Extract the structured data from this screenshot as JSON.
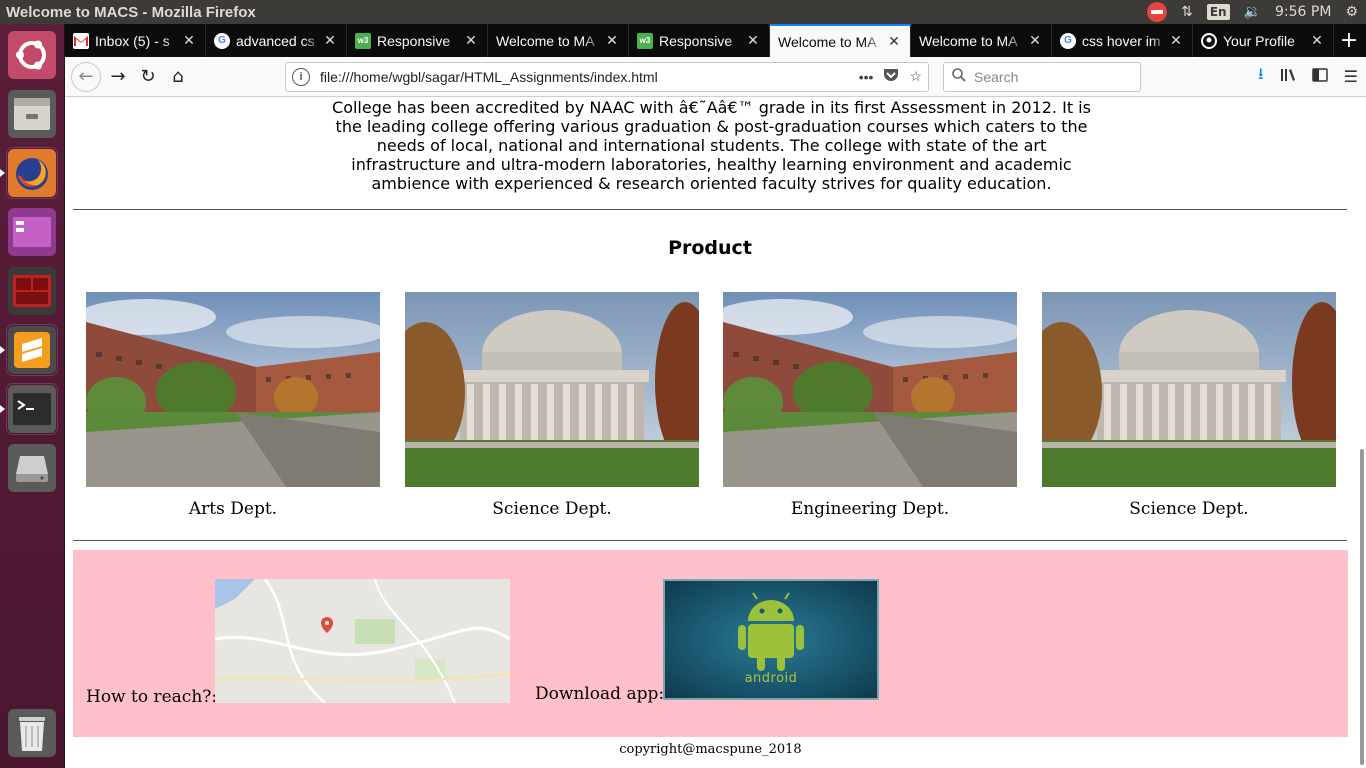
{
  "top_panel": {
    "window_title": "Welcome to MACS - Mozilla Firefox",
    "language": "En",
    "clock": "9:56 PM"
  },
  "launcher": {
    "items": [
      "ubuntu-dash-icon",
      "files-icon",
      "firefox-icon",
      "media-icon",
      "system-monitor-icon",
      "sublime-text-icon",
      "terminal-icon",
      "disk-icon",
      "trash-icon"
    ]
  },
  "tabs": [
    {
      "label": "Inbox (5) - s",
      "icon": "gmail-icon",
      "selected": false
    },
    {
      "label": "advanced cs",
      "icon": "google-icon",
      "selected": false
    },
    {
      "label": "Responsive",
      "icon": "w3schools-icon",
      "selected": false
    },
    {
      "label": "Welcome to MA",
      "icon": "",
      "selected": false
    },
    {
      "label": "Responsive",
      "icon": "w3schools-icon",
      "selected": false
    },
    {
      "label": "Welcome to MA",
      "icon": "",
      "selected": true
    },
    {
      "label": "Welcome to MA",
      "icon": "",
      "selected": false
    },
    {
      "label": "css hover im",
      "icon": "google-icon",
      "selected": false
    },
    {
      "label": "Your Profile",
      "icon": "github-icon",
      "selected": false
    }
  ],
  "navbar": {
    "url": "file:///home/wgbl/sagar/HTML_Assignments/index.html",
    "search_placeholder": "Search"
  },
  "page": {
    "intro_lines": [
      "College has been accredited by NAAC with â€˜Aâ€™ grade in its first Assessment in 2012. It is",
      "the leading college offering various graduation & post-graduation courses which caters to the",
      "needs of local, national and international students. The college with state of the art",
      "infrastructure and ultra-modern laboratories, healthy learning environment and academic",
      "ambience with experienced & research oriented faculty strives for quality education."
    ],
    "product_title": "Product",
    "departments": [
      {
        "caption": "Arts Dept.",
        "image": "campus-photo"
      },
      {
        "caption": "Science Dept.",
        "image": "dome-building-photo"
      },
      {
        "caption": "Engineering Dept.",
        "image": "campus-photo"
      },
      {
        "caption": "Science Dept.",
        "image": "dome-building-photo"
      }
    ],
    "how_to_reach": "How to reach?:",
    "download_app": "Download app:",
    "android_word": "android",
    "copyright": "copyright@macspune_2018",
    "footer_bg": "#ffc0cb"
  }
}
